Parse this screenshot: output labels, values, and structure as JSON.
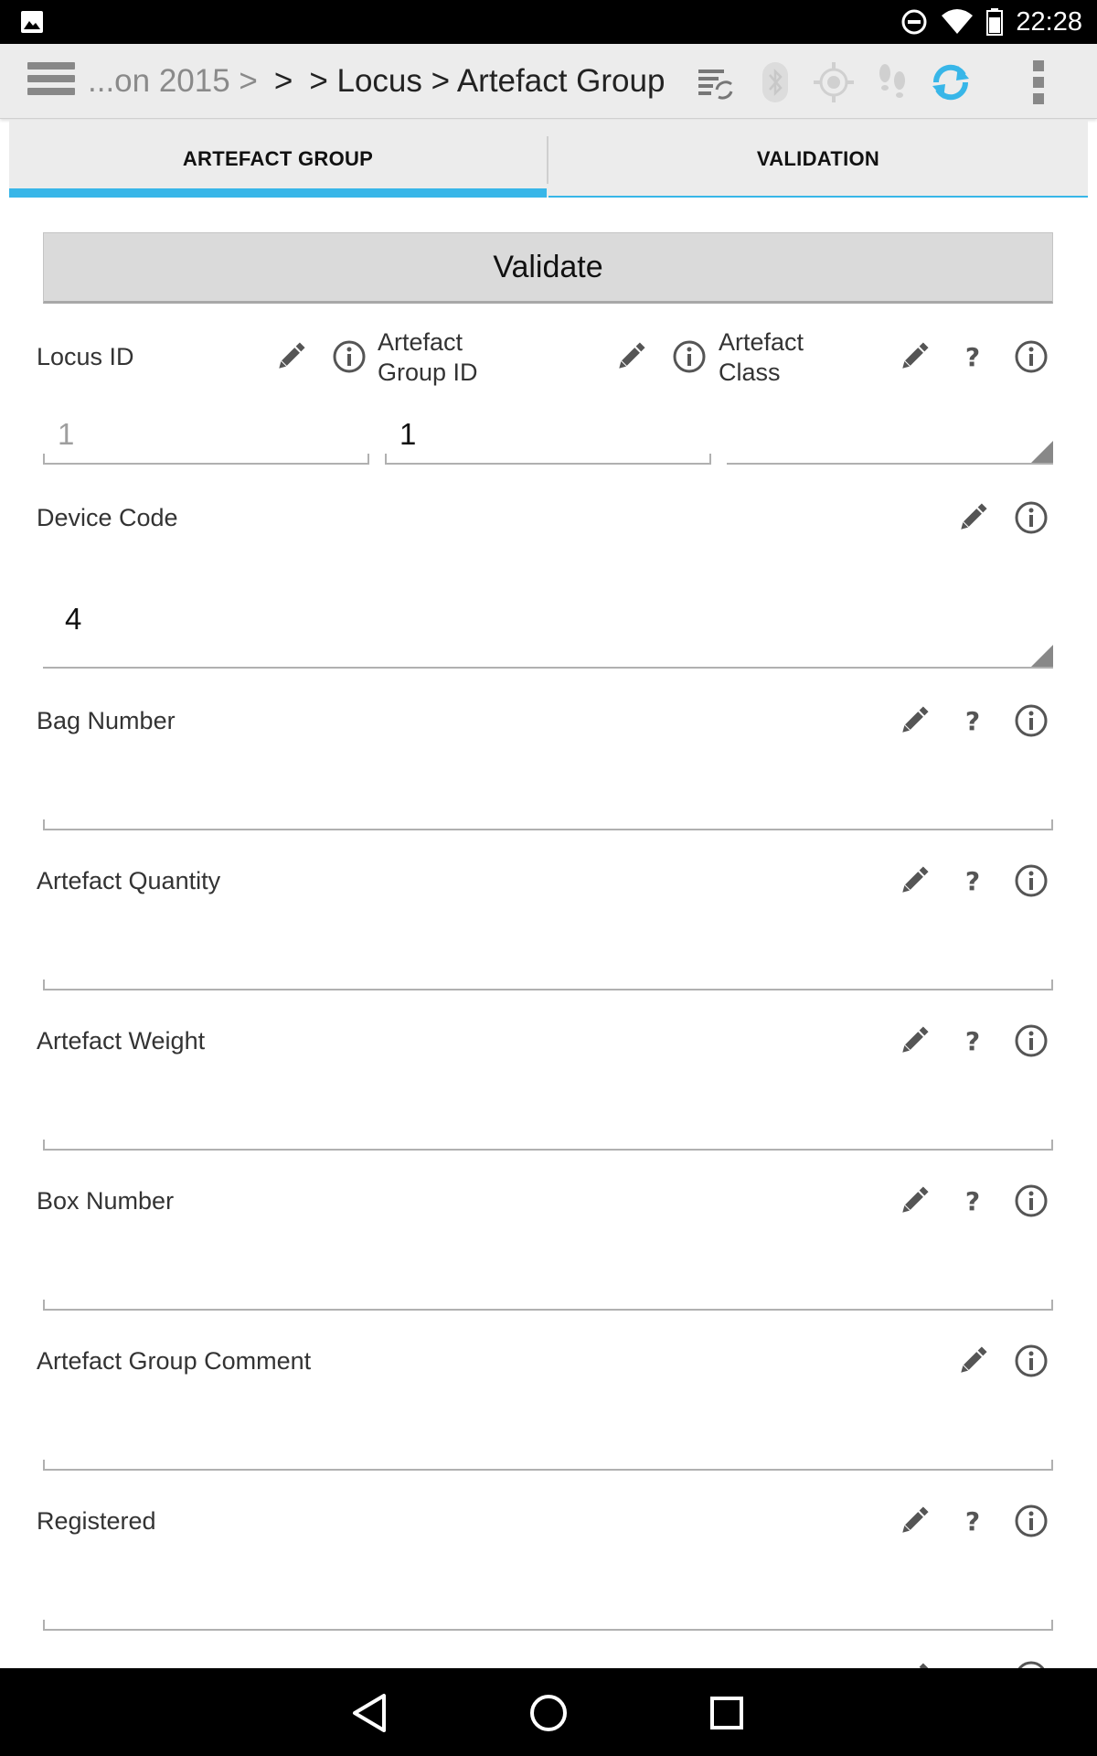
{
  "status_bar": {
    "time": "22:28"
  },
  "app_bar": {
    "breadcrumb_faded": "...on 2015 >",
    "breadcrumb_sep": ">",
    "breadcrumb_tail": "> Locus > Artefact Group"
  },
  "tabs": [
    {
      "label": "ARTEFACT GROUP",
      "selected": true
    },
    {
      "label": "VALIDATION",
      "selected": false
    }
  ],
  "validate_label": "Validate",
  "fields": {
    "locus_id": {
      "label": "Locus ID",
      "value": "1"
    },
    "artefact_group_id": {
      "label_1": "Artefact",
      "label_2": "Group ID",
      "value": "1"
    },
    "artefact_class": {
      "label_1": "Artefact",
      "label_2": "Class",
      "value": ""
    },
    "device_code": {
      "label": "Device Code",
      "value": "4"
    },
    "bag_number": {
      "label": "Bag Number",
      "value": ""
    },
    "artefact_quantity": {
      "label": "Artefact Quantity",
      "value": ""
    },
    "artefact_weight": {
      "label": "Artefact Weight",
      "value": ""
    },
    "box_number": {
      "label": "Box Number",
      "value": ""
    },
    "artefact_group_comment": {
      "label": "Artefact Group Comment",
      "value": ""
    },
    "registered": {
      "label": "Registered",
      "value": ""
    }
  },
  "help_glyph": "?",
  "colors": {
    "accent": "#38b6e8",
    "sync_active": "#38b6e8",
    "icon_gray": "#555555",
    "disabled_value": "#9e9e9e"
  }
}
